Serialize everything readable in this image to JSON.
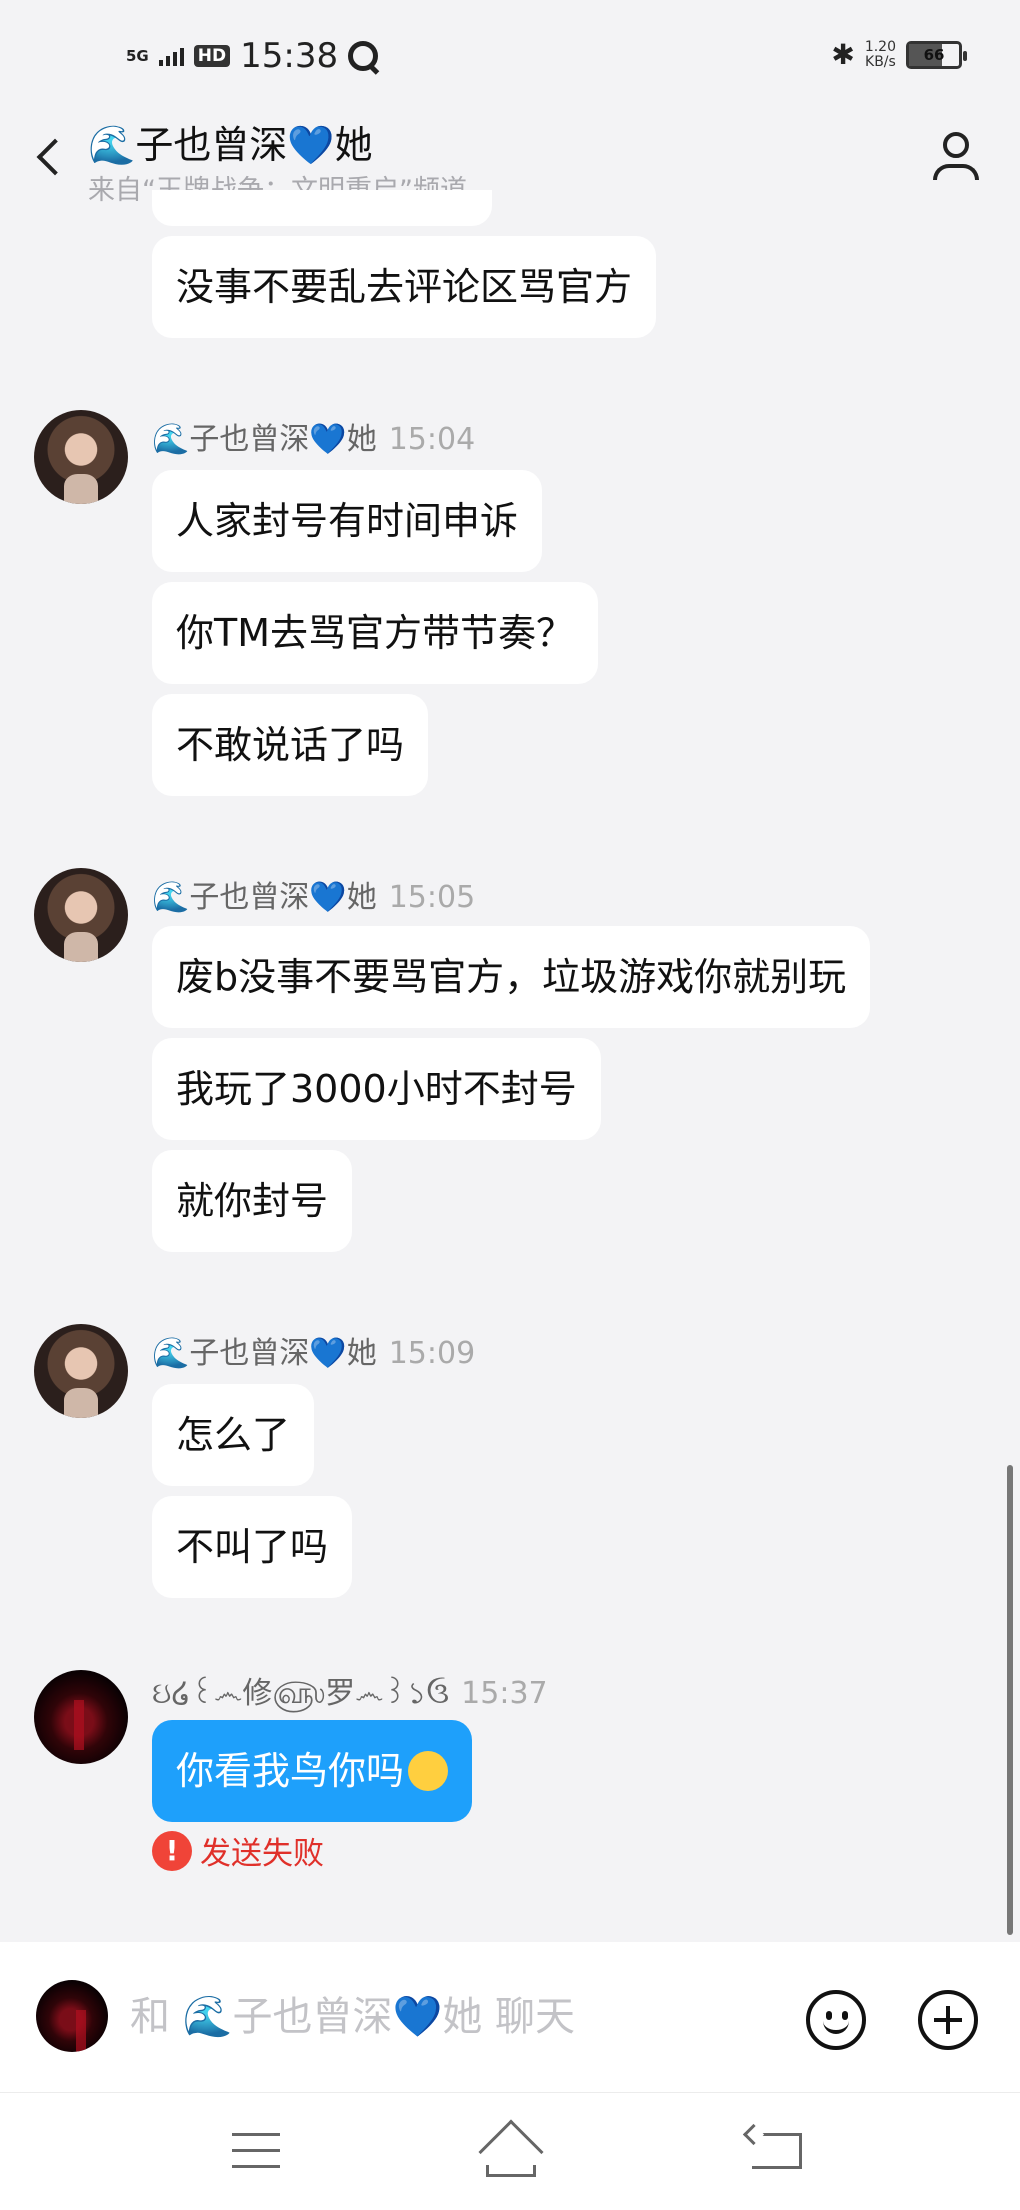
{
  "status_bar": {
    "network": "5G",
    "hd": "HD",
    "time": "15:38",
    "speed_value": "1.20",
    "speed_unit": "KB/s",
    "battery": "66"
  },
  "header": {
    "title": "🌊子也曾深💙她",
    "subtitle": "来自“王牌战争：文明重启”频道"
  },
  "messages": {
    "m0": {
      "text": "没事不要乱去评论区骂官方"
    },
    "g1": {
      "sender": "🌊子也曾深💙她",
      "time": "15:04",
      "lines": [
        "人家封号有时间申诉",
        "你TM去骂官方带节奏？",
        "不敢说话了吗"
      ]
    },
    "g2": {
      "sender": "🌊子也曾深💙她",
      "time": "15:05",
      "lines": [
        "废b没事不要骂官方，垃圾游戏你就别玩",
        "我玩了3000小时不封号",
        "就你封号"
      ]
    },
    "g3": {
      "sender": "🌊子也曾深💙她",
      "time": "15:09",
      "lines": [
        "怎么了",
        "不叫了吗"
      ]
    },
    "g4": {
      "sender": "ઇ໒꒰෴修௵罗෴꒱১ઉ",
      "time": "15:37",
      "text": "你看我鸟你吗",
      "status": "发送失败"
    }
  },
  "input": {
    "placeholder": "和 🌊子也曾深💙她 聊天"
  },
  "icons": [
    "back-icon",
    "profile-icon",
    "emoji-icon",
    "plus-icon",
    "menu-icon",
    "home-icon",
    "return-icon",
    "error-icon"
  ],
  "colors": {
    "background": "#f3f3f5",
    "sent_bubble": "#1ea0fb",
    "error": "#f04438"
  }
}
